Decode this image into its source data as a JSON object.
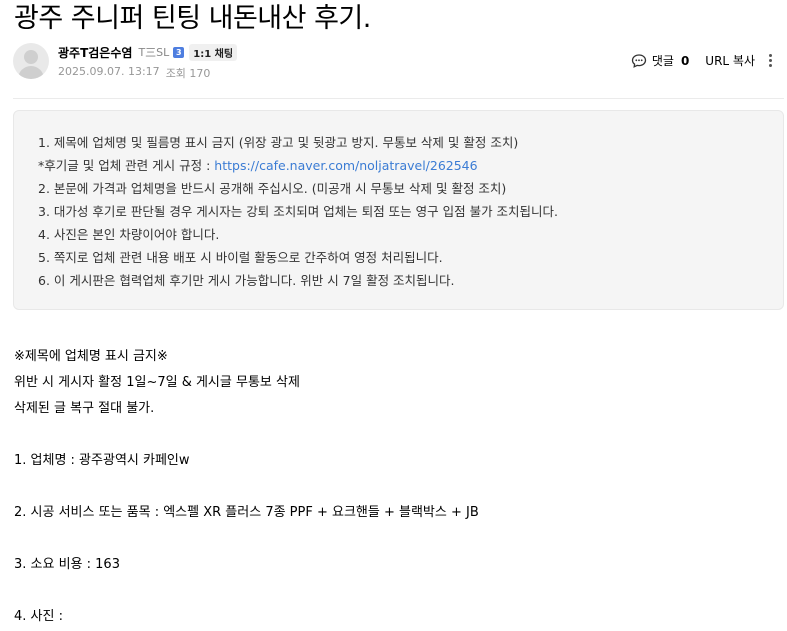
{
  "post": {
    "title": "광주 주니퍼 틴팅 내돈내산 후기."
  },
  "author": {
    "name": "광주T검은수염",
    "grade": "T三SL",
    "level": "3",
    "chat_label": "1:1 채팅",
    "date": "2025.09.07. 13:17",
    "views_label": "조회 170"
  },
  "toolbar": {
    "comment_label": "댓글",
    "comment_count": "0",
    "url_copy_label": "URL 복사"
  },
  "notice": {
    "line1": "1. 제목에 업체명 및 필름명 표시 금지 (위장 광고 및 뒷광고 방지. 무통보 삭제 및 활정 조치)",
    "line2_prefix": "*후기글 및 업체 관련 게시 규정 : ",
    "line2_link": "https://cafe.naver.com/noljatravel/262546",
    "line3": "2. 본문에 가격과 업체명을 반드시 공개해 주십시오. (미공개 시 무통보 삭제 및 활정 조치)",
    "line4": "3. 대가성 후기로 판단될 경우 게시자는 강퇴 조치되며 업체는 퇴점 또는 영구 입점 불가 조치됩니다.",
    "line5": "4. 사진은 본인 차량이어야 합니다.",
    "line6": "5. 쪽지로 업체 관련 내용 배포 시 바이럴 활동으로 간주하여 영정 처리됩니다.",
    "line7": "6. 이 게시판은 협력업체 후기만 게시 가능합니다. 위반 시 7일 활정 조치됩니다."
  },
  "content": {
    "warning1": "※제목에 업체명 표시 금지※",
    "warning2": "위반 시 게시자 활정 1일~7일 & 게시글 무통보 삭제",
    "warning3": "삭제된 글 복구 절대 불가.",
    "item1": "1. 업체명 : 광주광역시 카페인w",
    "item2": "2. 시공 서비스 또는 품목 : 엑스펠 XR 플러스 7종 PPF + 요크핸들 + 블랙박스 + JB",
    "item3": "3. 소요 비용 : 163",
    "item4": "4. 사진 :"
  },
  "icons": {
    "comment": "comment-bubble-icon",
    "more": "more-vertical-icon",
    "avatar": "default-avatar-icon"
  },
  "colors": {
    "link": "#3b7cd4",
    "notice_bg": "#f5f5f5",
    "meta_text": "#979797"
  }
}
